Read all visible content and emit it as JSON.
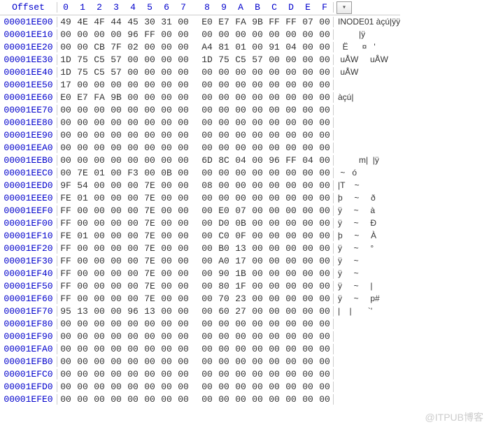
{
  "header": {
    "offset_label": "Offset",
    "columns": [
      "0",
      "1",
      "2",
      "3",
      "4",
      "5",
      "6",
      "7",
      "8",
      "9",
      "A",
      "B",
      "C",
      "D",
      "E",
      "F"
    ],
    "dropdown_icon": "▾"
  },
  "watermark": "@ITPUB博客",
  "rows": [
    {
      "offset": "00001EE00",
      "hex": [
        "49",
        "4E",
        "4F",
        "44",
        "45",
        "30",
        "31",
        "00",
        "E0",
        "E7",
        "FA",
        "9B",
        "FF",
        "FF",
        "07",
        "00"
      ],
      "ascii": "INODE01 àçú|ÿÿ"
    },
    {
      "offset": "00001EE10",
      "hex": [
        "00",
        "00",
        "00",
        "00",
        "96",
        "FF",
        "00",
        "00",
        "00",
        "00",
        "00",
        "00",
        "00",
        "00",
        "00",
        "00"
      ],
      "ascii": "         |ÿ"
    },
    {
      "offset": "00001EE20",
      "hex": [
        "00",
        "00",
        "CB",
        "7F",
        "02",
        "00",
        "00",
        "00",
        "A4",
        "81",
        "01",
        "00",
        "91",
        "04",
        "00",
        "00"
      ],
      "ascii": "  Ë      ¤   '"
    },
    {
      "offset": "00001EE30",
      "hex": [
        "1D",
        "75",
        "C5",
        "57",
        "00",
        "00",
        "00",
        "00",
        "1D",
        "75",
        "C5",
        "57",
        "00",
        "00",
        "00",
        "00"
      ],
      "ascii": " uÅW     uÅW"
    },
    {
      "offset": "00001EE40",
      "hex": [
        "1D",
        "75",
        "C5",
        "57",
        "00",
        "00",
        "00",
        "00",
        "00",
        "00",
        "00",
        "00",
        "00",
        "00",
        "00",
        "00"
      ],
      "ascii": " uÅW"
    },
    {
      "offset": "00001EE50",
      "hex": [
        "17",
        "00",
        "00",
        "00",
        "00",
        "00",
        "00",
        "00",
        "00",
        "00",
        "00",
        "00",
        "00",
        "00",
        "00",
        "00"
      ],
      "ascii": ""
    },
    {
      "offset": "00001EE60",
      "hex": [
        "E0",
        "E7",
        "FA",
        "9B",
        "00",
        "00",
        "00",
        "00",
        "00",
        "00",
        "00",
        "00",
        "00",
        "00",
        "00",
        "00"
      ],
      "ascii": "àçú|"
    },
    {
      "offset": "00001EE70",
      "hex": [
        "00",
        "00",
        "00",
        "00",
        "00",
        "00",
        "00",
        "00",
        "00",
        "00",
        "00",
        "00",
        "00",
        "00",
        "00",
        "00"
      ],
      "ascii": ""
    },
    {
      "offset": "00001EE80",
      "hex": [
        "00",
        "00",
        "00",
        "00",
        "00",
        "00",
        "00",
        "00",
        "00",
        "00",
        "00",
        "00",
        "00",
        "00",
        "00",
        "00"
      ],
      "ascii": ""
    },
    {
      "offset": "00001EE90",
      "hex": [
        "00",
        "00",
        "00",
        "00",
        "00",
        "00",
        "00",
        "00",
        "00",
        "00",
        "00",
        "00",
        "00",
        "00",
        "00",
        "00"
      ],
      "ascii": ""
    },
    {
      "offset": "00001EEA0",
      "hex": [
        "00",
        "00",
        "00",
        "00",
        "00",
        "00",
        "00",
        "00",
        "00",
        "00",
        "00",
        "00",
        "00",
        "00",
        "00",
        "00"
      ],
      "ascii": ""
    },
    {
      "offset": "00001EEB0",
      "hex": [
        "00",
        "00",
        "00",
        "00",
        "00",
        "00",
        "00",
        "00",
        "6D",
        "8C",
        "04",
        "00",
        "96",
        "FF",
        "04",
        "00"
      ],
      "ascii": "         m|  |ÿ"
    },
    {
      "offset": "00001EEC0",
      "hex": [
        "00",
        "7E",
        "01",
        "00",
        "F3",
        "00",
        "0B",
        "00",
        "00",
        "00",
        "00",
        "00",
        "00",
        "00",
        "00",
        "00"
      ],
      "ascii": " ~   ó"
    },
    {
      "offset": "00001EED0",
      "hex": [
        "9F",
        "54",
        "00",
        "00",
        "00",
        "7E",
        "00",
        "00",
        "08",
        "00",
        "00",
        "00",
        "00",
        "00",
        "00",
        "00"
      ],
      "ascii": "|T    ~"
    },
    {
      "offset": "00001EEE0",
      "hex": [
        "FE",
        "01",
        "00",
        "00",
        "00",
        "7E",
        "00",
        "00",
        "00",
        "00",
        "00",
        "00",
        "00",
        "00",
        "00",
        "00"
      ],
      "ascii": "þ     ~     ð"
    },
    {
      "offset": "00001EEF0",
      "hex": [
        "FF",
        "00",
        "00",
        "00",
        "00",
        "7E",
        "00",
        "00",
        "00",
        "E0",
        "07",
        "00",
        "00",
        "00",
        "00",
        "00"
      ],
      "ascii": "ÿ     ~     à"
    },
    {
      "offset": "00001EF00",
      "hex": [
        "FF",
        "00",
        "00",
        "00",
        "00",
        "7E",
        "00",
        "00",
        "00",
        "D0",
        "0B",
        "00",
        "00",
        "00",
        "00",
        "00"
      ],
      "ascii": "ÿ     ~     Ð"
    },
    {
      "offset": "00001EF10",
      "hex": [
        "FE",
        "01",
        "00",
        "00",
        "00",
        "7E",
        "00",
        "00",
        "00",
        "C0",
        "0F",
        "00",
        "00",
        "00",
        "00",
        "00"
      ],
      "ascii": "þ     ~     À"
    },
    {
      "offset": "00001EF20",
      "hex": [
        "FF",
        "00",
        "00",
        "00",
        "00",
        "7E",
        "00",
        "00",
        "00",
        "B0",
        "13",
        "00",
        "00",
        "00",
        "00",
        "00"
      ],
      "ascii": "ÿ     ~     °"
    },
    {
      "offset": "00001EF30",
      "hex": [
        "FF",
        "00",
        "00",
        "00",
        "00",
        "7E",
        "00",
        "00",
        "00",
        "A0",
        "17",
        "00",
        "00",
        "00",
        "00",
        "00"
      ],
      "ascii": "ÿ     ~"
    },
    {
      "offset": "00001EF40",
      "hex": [
        "FF",
        "00",
        "00",
        "00",
        "00",
        "7E",
        "00",
        "00",
        "00",
        "90",
        "1B",
        "00",
        "00",
        "00",
        "00",
        "00"
      ],
      "ascii": "ÿ     ~"
    },
    {
      "offset": "00001EF50",
      "hex": [
        "FF",
        "00",
        "00",
        "00",
        "00",
        "7E",
        "00",
        "00",
        "00",
        "80",
        "1F",
        "00",
        "00",
        "00",
        "00",
        "00"
      ],
      "ascii": "ÿ     ~     |"
    },
    {
      "offset": "00001EF60",
      "hex": [
        "FF",
        "00",
        "00",
        "00",
        "00",
        "7E",
        "00",
        "00",
        "00",
        "70",
        "23",
        "00",
        "00",
        "00",
        "00",
        "00"
      ],
      "ascii": "ÿ     ~     p#"
    },
    {
      "offset": "00001EF70",
      "hex": [
        "95",
        "13",
        "00",
        "00",
        "96",
        "13",
        "00",
        "00",
        "00",
        "60",
        "27",
        "00",
        "00",
        "00",
        "00",
        "00"
      ],
      "ascii": "|    |       `'"
    },
    {
      "offset": "00001EF80",
      "hex": [
        "00",
        "00",
        "00",
        "00",
        "00",
        "00",
        "00",
        "00",
        "00",
        "00",
        "00",
        "00",
        "00",
        "00",
        "00",
        "00"
      ],
      "ascii": ""
    },
    {
      "offset": "00001EF90",
      "hex": [
        "00",
        "00",
        "00",
        "00",
        "00",
        "00",
        "00",
        "00",
        "00",
        "00",
        "00",
        "00",
        "00",
        "00",
        "00",
        "00"
      ],
      "ascii": ""
    },
    {
      "offset": "00001EFA0",
      "hex": [
        "00",
        "00",
        "00",
        "00",
        "00",
        "00",
        "00",
        "00",
        "00",
        "00",
        "00",
        "00",
        "00",
        "00",
        "00",
        "00"
      ],
      "ascii": ""
    },
    {
      "offset": "00001EFB0",
      "hex": [
        "00",
        "00",
        "00",
        "00",
        "00",
        "00",
        "00",
        "00",
        "00",
        "00",
        "00",
        "00",
        "00",
        "00",
        "00",
        "00"
      ],
      "ascii": ""
    },
    {
      "offset": "00001EFC0",
      "hex": [
        "00",
        "00",
        "00",
        "00",
        "00",
        "00",
        "00",
        "00",
        "00",
        "00",
        "00",
        "00",
        "00",
        "00",
        "00",
        "00"
      ],
      "ascii": ""
    },
    {
      "offset": "00001EFD0",
      "hex": [
        "00",
        "00",
        "00",
        "00",
        "00",
        "00",
        "00",
        "00",
        "00",
        "00",
        "00",
        "00",
        "00",
        "00",
        "00",
        "00"
      ],
      "ascii": ""
    },
    {
      "offset": "00001EFE0",
      "hex": [
        "00",
        "00",
        "00",
        "00",
        "00",
        "00",
        "00",
        "00",
        "00",
        "00",
        "00",
        "00",
        "00",
        "00",
        "00",
        "00"
      ],
      "ascii": ""
    }
  ]
}
